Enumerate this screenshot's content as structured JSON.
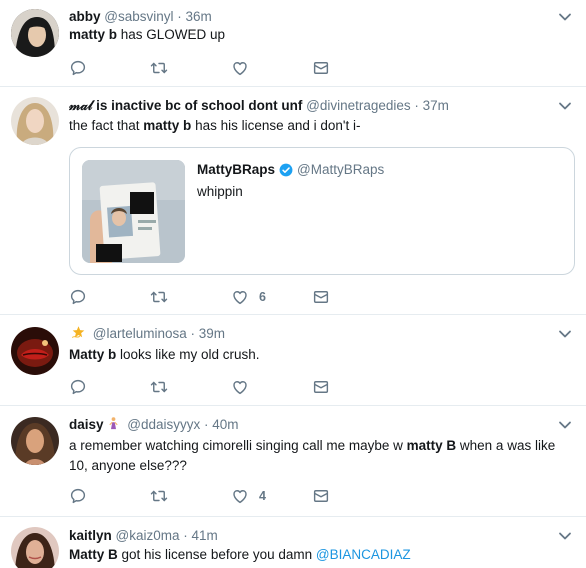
{
  "tweets": [
    {
      "name": "abby",
      "handle": "@sabsvinyl",
      "time": "· 36m",
      "text_bold": "matty b",
      "text_rest": " has GLOWED up",
      "likes": "",
      "avatar_colors": [
        "#2a2a2a",
        "#d9c9b8"
      ]
    },
    {
      "name": "𝓂𝒶𝓁 is inactive bc of school dont unf",
      "handle": "@divinetragedies",
      "time": "· 37m",
      "text_pre": "the fact that ",
      "text_bold": "matty b",
      "text_rest": " has his license and i don't i-",
      "likes": "6",
      "quote": {
        "name": "MattyBRaps",
        "handle": "@MattyBRaps",
        "text": "whippin"
      }
    },
    {
      "name": "",
      "handle": "@larteluminosa",
      "time": "· 39m",
      "text_bold": "Matty b",
      "text_rest": " looks like my old crush.",
      "likes": ""
    },
    {
      "name": "daisy",
      "handle": "@ddaisyyyx",
      "time": "· 40m",
      "text_pre": "a remember watching cimorelli singing call me maybe w ",
      "text_bold": "matty B",
      "text_rest": " when a was like 10, anyone else???",
      "likes": "4"
    },
    {
      "name": "kaitlyn",
      "handle": "@kaiz0ma",
      "time": "· 41m",
      "text_bold": "Matty B",
      "text_rest": " got his license before you damn ",
      "mention": "@BIANCADIAZ",
      "likes": ""
    }
  ],
  "colors": {
    "icon": "#657786",
    "mention": "#1b95e0",
    "divider": "#e6ecf0",
    "verified": "#1da1f2"
  },
  "icons": [
    "reply-icon",
    "retweet-icon",
    "like-icon",
    "message-icon",
    "chevron-down-icon",
    "verified-badge-icon"
  ]
}
